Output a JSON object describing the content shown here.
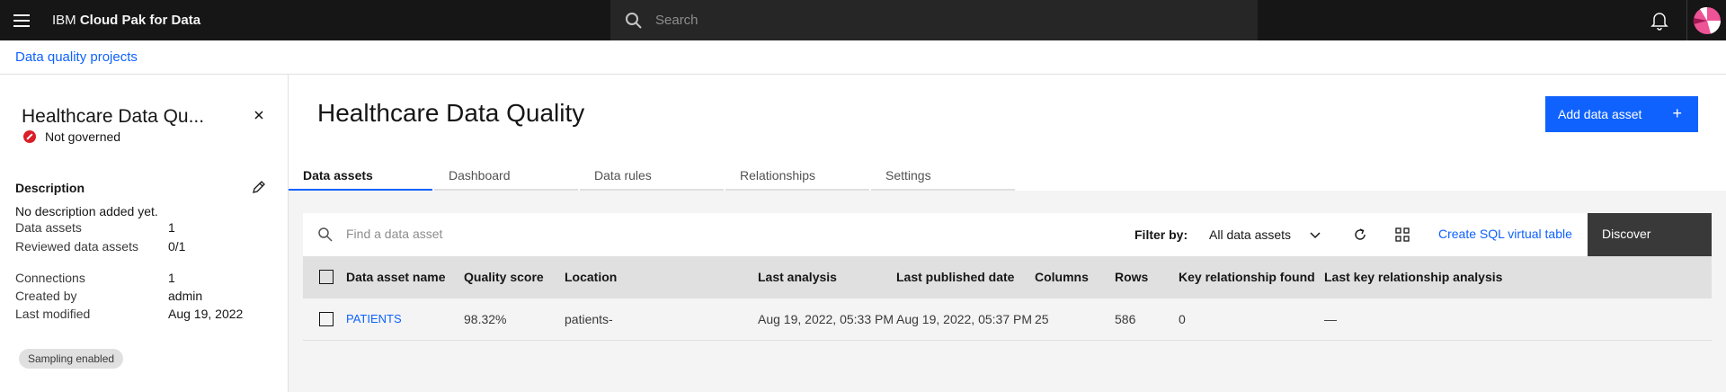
{
  "header": {
    "brand_light": "IBM ",
    "brand_bold": "Cloud Pak for Data",
    "search_placeholder": "Search"
  },
  "breadcrumb": {
    "label": "Data quality projects"
  },
  "side_panel": {
    "title": "Healthcare Data Qu...",
    "governance": "Not governed",
    "description_heading": "Description",
    "description_value": "No description added yet.",
    "stats": [
      {
        "key": "Data assets",
        "value": "1"
      },
      {
        "key": "Reviewed data assets",
        "value": "0/1"
      },
      {
        "key": "Connections",
        "value": "1"
      },
      {
        "key": "Created by",
        "value": "admin"
      },
      {
        "key": "Last modified",
        "value": "Aug 19, 2022"
      }
    ],
    "tag": "Sampling enabled"
  },
  "main": {
    "title": "Healthcare Data Quality",
    "add_button": "Add data asset",
    "add_button_icon": "+",
    "tabs": [
      {
        "label": "Data assets",
        "active": true
      },
      {
        "label": "Dashboard",
        "active": false
      },
      {
        "label": "Data rules",
        "active": false
      },
      {
        "label": "Relationships",
        "active": false
      },
      {
        "label": "Settings",
        "active": false
      }
    ],
    "toolbar": {
      "search_placeholder": "Find a data asset",
      "filter_label": "Filter by:",
      "filter_value": "All data assets",
      "sql_link": "Create SQL virtual table",
      "discover_button": "Discover"
    },
    "table": {
      "columns": [
        "Data asset name",
        "Quality score",
        "Location",
        "Last analysis",
        "Last published date",
        "Columns",
        "Rows",
        "Key relationship found",
        "Last key relationship analysis"
      ],
      "rows": [
        {
          "name": "PATIENTS",
          "quality": "98.32%",
          "location": "patients-",
          "last_analysis": "Aug 19, 2022, 05:33 PM",
          "last_published": "Aug 19, 2022, 05:37 PM",
          "columns": "25",
          "rows": "586",
          "key_rel": "0",
          "last_key": "—"
        }
      ]
    }
  },
  "colors": {
    "accent": "#0f62fe",
    "header_bg": "#161616",
    "danger": "#da1e28"
  }
}
